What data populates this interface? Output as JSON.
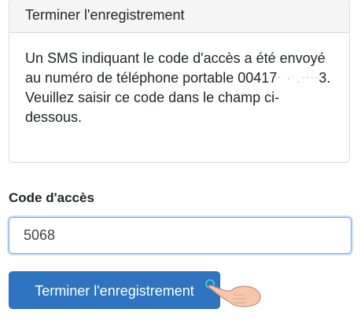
{
  "card": {
    "header": "Terminer l'enregistrement",
    "message_before": "Un SMS indiquant le code d'accès a été envoyé au numéro de téléphone portable 00417",
    "message_masked": "ᐧ · .ᐧᐧᐧᐧ",
    "message_after": "3. Veuillez saisir ce code dans le champ ci-dessous."
  },
  "form": {
    "label": "Code d'accès",
    "value": "5068"
  },
  "submit": {
    "label": "Terminer l'enregistrement"
  },
  "cursor": {
    "icon": "pointing-hand-icon"
  }
}
